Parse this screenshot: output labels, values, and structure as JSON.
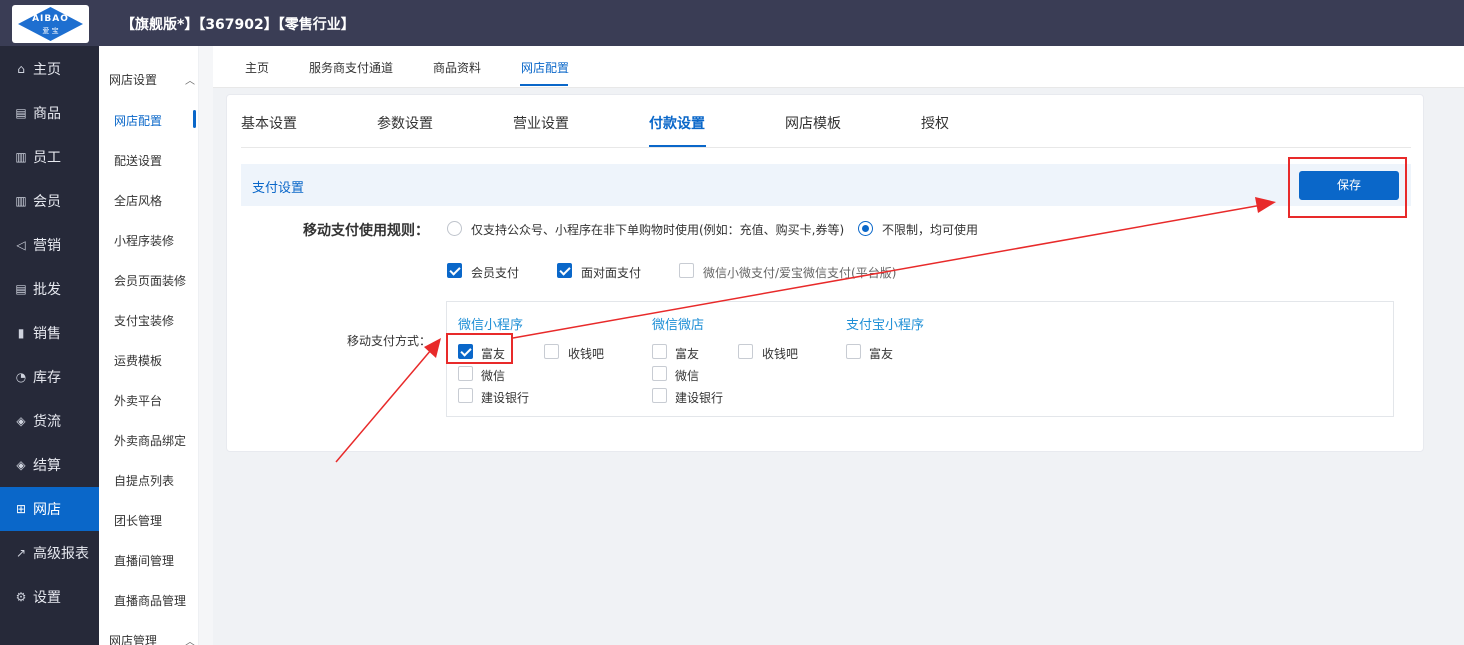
{
  "header": {
    "logo_text": "AIBAO",
    "logo_sub": "爱 宝",
    "title": "【旗舰版*】【367902】【零售行业】"
  },
  "left_nav": [
    {
      "label": "主页",
      "icon": "home-icon",
      "glyph": "⌂"
    },
    {
      "label": "商品",
      "icon": "goods-icon",
      "glyph": "▤"
    },
    {
      "label": "员工",
      "icon": "employee-icon",
      "glyph": "▥"
    },
    {
      "label": "会员",
      "icon": "member-icon",
      "glyph": "▥"
    },
    {
      "label": "营销",
      "icon": "megaphone-icon",
      "glyph": "◁"
    },
    {
      "label": "批发",
      "icon": "wholesale-icon",
      "glyph": "▤"
    },
    {
      "label": "销售",
      "icon": "sales-chart-icon",
      "glyph": "▮"
    },
    {
      "label": "库存",
      "icon": "inventory-pie-icon",
      "glyph": "◔"
    },
    {
      "label": "货流",
      "icon": "logistics-icon",
      "glyph": "◈"
    },
    {
      "label": "结算",
      "icon": "settlement-icon",
      "glyph": "◈"
    },
    {
      "label": "网店",
      "icon": "gift-shop-icon",
      "glyph": "🎁",
      "active": true
    },
    {
      "label": "高级报表",
      "icon": "line-chart-icon",
      "glyph": "↗"
    },
    {
      "label": "设置",
      "icon": "gear-icon",
      "glyph": "⚙"
    }
  ],
  "sub_nav": {
    "group1": "网店设置",
    "group2": "网店管理",
    "items": [
      "网店配置",
      "配送设置",
      "全店风格",
      "小程序装修",
      "会员页面装修",
      "支付宝装修",
      "运费模板",
      "外卖平台",
      "外卖商品绑定",
      "自提点列表",
      "团长管理",
      "直播间管理",
      "直播商品管理"
    ]
  },
  "page_tabs": [
    "主页",
    "服务商支付通道",
    "商品资料",
    "网店配置"
  ],
  "settings_tabs": [
    "基本设置",
    "参数设置",
    "营业设置",
    "付款设置",
    "网店模板",
    "授权"
  ],
  "section_title": "支付设置",
  "save_label": "保存",
  "rule": {
    "label": "移动支付使用规则：",
    "option1": "仅支持公众号、小程序在非下单购物时使用(例如：充值、购买卡,券等)",
    "option2": "不限制，均可使用",
    "selected": "option2"
  },
  "pay_types": [
    {
      "label": "会员支付",
      "checked": true
    },
    {
      "label": "面对面支付",
      "checked": true
    },
    {
      "label": "微信小微支付/爱宝微信支付(平台版)",
      "checked": false
    }
  ],
  "method": {
    "label": "移动支付方式：",
    "groups": [
      {
        "title": "微信小程序",
        "items": [
          {
            "label": "富友",
            "checked": true
          },
          {
            "label": "收钱吧",
            "checked": false
          },
          {
            "label": "微信",
            "checked": false
          },
          {
            "label": "建设银行",
            "checked": false
          }
        ]
      },
      {
        "title": "微信微店",
        "items": [
          {
            "label": "富友",
            "checked": false
          },
          {
            "label": "收钱吧",
            "checked": false
          },
          {
            "label": "微信",
            "checked": false
          },
          {
            "label": "建设银行",
            "checked": false
          }
        ]
      },
      {
        "title": "支付宝小程序",
        "items": [
          {
            "label": "富友",
            "checked": false
          }
        ]
      }
    ]
  },
  "colors": {
    "primary": "#0a67c9",
    "nav_bg": "#262939",
    "top_bg": "#3a3d55",
    "annotation": "#e82a2a",
    "group_title": "#1f8fd6"
  }
}
